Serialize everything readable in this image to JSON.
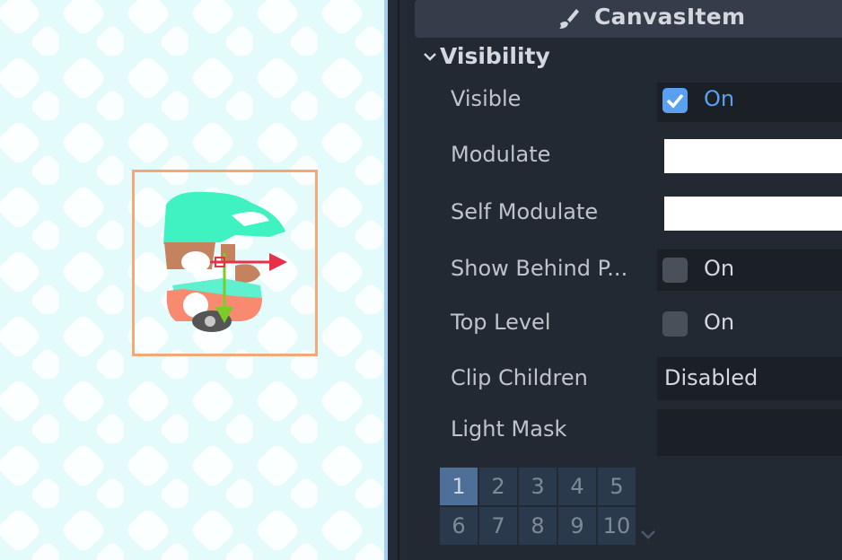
{
  "inspector": {
    "header_title": "CanvasItem",
    "section_title": "Visibility",
    "props": {
      "visible": {
        "label": "Visible",
        "checked": true,
        "value": "On"
      },
      "modulate": {
        "label": "Modulate",
        "color": "#ffffff"
      },
      "self_modulate": {
        "label": "Self Modulate",
        "color": "#ffffff"
      },
      "show_behind": {
        "label": "Show Behind P...",
        "checked": false,
        "value": "On"
      },
      "top_level": {
        "label": "Top Level",
        "checked": false,
        "value": "On"
      },
      "clip_children": {
        "label": "Clip Children",
        "value": "Disabled"
      },
      "light_mask": {
        "label": "Light Mask",
        "layers": [
          "1",
          "2",
          "3",
          "4",
          "5",
          "6",
          "7",
          "8",
          "9",
          "10"
        ],
        "selected": "1"
      }
    }
  },
  "colors": {
    "accent": "#5aa0f0",
    "selection_box": "#f2a878",
    "x_axis": "#e8304a",
    "y_axis": "#7ccc28"
  },
  "icons": [
    "paint-brush-icon",
    "chevron-down-icon",
    "checkbox-checked-icon",
    "checkbox-unchecked-icon",
    "move-gizmo-icon"
  ]
}
